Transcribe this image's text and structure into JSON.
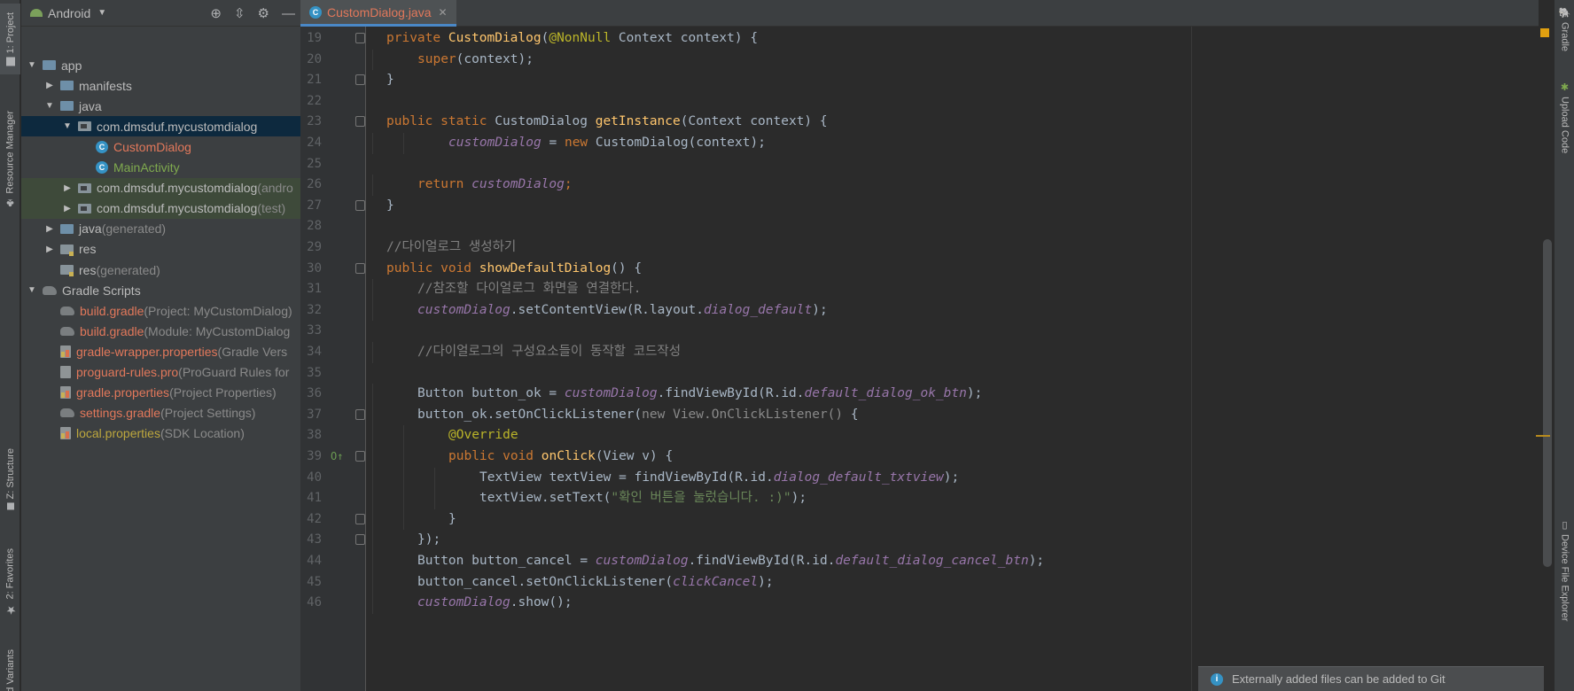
{
  "left_tabs": [
    "1: Project",
    "Resource Manager",
    "Z: Structure",
    "2: Favorites",
    "Build Variants"
  ],
  "project": {
    "view_mode": "Android",
    "tree": [
      {
        "label": "app",
        "suffix": "",
        "depth": 0,
        "arrow": "▼",
        "icon": "folder-app",
        "color": "default",
        "state": ""
      },
      {
        "label": "manifests",
        "suffix": "",
        "depth": 1,
        "arrow": "▶",
        "icon": "folder",
        "color": "default",
        "state": ""
      },
      {
        "label": "java",
        "suffix": "",
        "depth": 1,
        "arrow": "▼",
        "icon": "folder-blue",
        "color": "default",
        "state": ""
      },
      {
        "label": "com.dmsduf.mycustomdialog",
        "suffix": "",
        "depth": 2,
        "arrow": "▼",
        "icon": "package",
        "color": "default",
        "state": "selected"
      },
      {
        "label": "CustomDialog",
        "suffix": "",
        "depth": 3,
        "arrow": "",
        "icon": "class",
        "color": "red",
        "state": ""
      },
      {
        "label": "MainActivity",
        "suffix": "",
        "depth": 3,
        "arrow": "",
        "icon": "class",
        "color": "green",
        "state": ""
      },
      {
        "label": "com.dmsduf.mycustomdialog",
        "suffix": "(andro",
        "depth": 2,
        "arrow": "▶",
        "icon": "package",
        "color": "default",
        "state": "test"
      },
      {
        "label": "com.dmsduf.mycustomdialog",
        "suffix": "(test)",
        "depth": 2,
        "arrow": "▶",
        "icon": "package",
        "color": "default",
        "state": "test"
      },
      {
        "label": "java",
        "suffix": "(generated)",
        "depth": 1,
        "arrow": "▶",
        "icon": "folder-blue",
        "color": "default",
        "state": ""
      },
      {
        "label": "res",
        "suffix": "",
        "depth": 1,
        "arrow": "▶",
        "icon": "folder-res",
        "color": "default",
        "state": ""
      },
      {
        "label": "res",
        "suffix": "(generated)",
        "depth": 1,
        "arrow": "",
        "icon": "folder-res",
        "color": "default",
        "state": ""
      },
      {
        "label": "Gradle Scripts",
        "suffix": "",
        "depth": 0,
        "arrow": "▼",
        "icon": "gradle",
        "color": "default",
        "state": ""
      },
      {
        "label": "build.gradle",
        "suffix": "(Project: MyCustomDialog)",
        "depth": 1,
        "arrow": "",
        "icon": "gradle",
        "color": "red",
        "state": ""
      },
      {
        "label": "build.gradle",
        "suffix": "(Module: MyCustomDialog",
        "depth": 1,
        "arrow": "",
        "icon": "gradle",
        "color": "red",
        "state": ""
      },
      {
        "label": "gradle-wrapper.properties",
        "suffix": "(Gradle Vers",
        "depth": 1,
        "arrow": "",
        "icon": "properties",
        "color": "red",
        "state": ""
      },
      {
        "label": "proguard-rules.pro",
        "suffix": "(ProGuard Rules for",
        "depth": 1,
        "arrow": "",
        "icon": "file",
        "color": "red",
        "state": ""
      },
      {
        "label": "gradle.properties",
        "suffix": "(Project Properties)",
        "depth": 1,
        "arrow": "",
        "icon": "properties",
        "color": "red",
        "state": ""
      },
      {
        "label": "settings.gradle",
        "suffix": "(Project Settings)",
        "depth": 1,
        "arrow": "",
        "icon": "gradle",
        "color": "red",
        "state": ""
      },
      {
        "label": "local.properties",
        "suffix": "(SDK Location)",
        "depth": 1,
        "arrow": "",
        "icon": "properties",
        "color": "yellow",
        "state": ""
      }
    ]
  },
  "editor": {
    "tab_label": "CustomDialog.java",
    "lines": [
      {
        "n": 19,
        "indent": 1,
        "fold": true,
        "marker": "",
        "tokens": [
          [
            "k",
            "private "
          ],
          [
            "f",
            "CustomDialog"
          ],
          [
            "p",
            "("
          ],
          [
            "an",
            "@NonNull"
          ],
          [
            "p",
            " Context context) {"
          ]
        ]
      },
      {
        "n": 20,
        "indent": 2,
        "fold": false,
        "marker": "",
        "tokens": [
          [
            "k",
            "super"
          ],
          [
            "p",
            "(context);"
          ]
        ]
      },
      {
        "n": 21,
        "indent": 1,
        "fold": true,
        "marker": "",
        "tokens": [
          [
            "p",
            "}"
          ]
        ]
      },
      {
        "n": 22,
        "indent": 0,
        "fold": false,
        "marker": "",
        "tokens": []
      },
      {
        "n": 23,
        "indent": 1,
        "fold": true,
        "marker": "",
        "tokens": [
          [
            "k",
            "public static "
          ],
          [
            "p",
            "CustomDialog "
          ],
          [
            "f",
            "getInstance"
          ],
          [
            "p",
            "(Context context) {"
          ]
        ]
      },
      {
        "n": 24,
        "indent": 3,
        "fold": false,
        "marker": "",
        "tokens": [
          [
            "iv",
            "customDialog"
          ],
          [
            "p",
            " = "
          ],
          [
            "k",
            "new "
          ],
          [
            "p",
            "CustomDialog(context);"
          ]
        ]
      },
      {
        "n": 25,
        "indent": 0,
        "fold": false,
        "marker": "",
        "tokens": []
      },
      {
        "n": 26,
        "indent": 2,
        "fold": false,
        "marker": "",
        "tokens": [
          [
            "k",
            "return "
          ],
          [
            "iv",
            "customDialog"
          ],
          [
            "k",
            ";"
          ]
        ]
      },
      {
        "n": 27,
        "indent": 1,
        "fold": true,
        "marker": "",
        "tokens": [
          [
            "p",
            "}"
          ]
        ]
      },
      {
        "n": 28,
        "indent": 0,
        "fold": false,
        "marker": "",
        "tokens": []
      },
      {
        "n": 29,
        "indent": 1,
        "fold": false,
        "marker": "",
        "tokens": [
          [
            "c",
            "//다이얼로그 생성하기"
          ]
        ]
      },
      {
        "n": 30,
        "indent": 1,
        "fold": true,
        "marker": "",
        "tokens": [
          [
            "k",
            "public void "
          ],
          [
            "f",
            "showDefaultDialog"
          ],
          [
            "p",
            "() {"
          ]
        ]
      },
      {
        "n": 31,
        "indent": 2,
        "fold": false,
        "marker": "",
        "tokens": [
          [
            "c",
            "//참조할 다이얼로그 화면을 연결한다."
          ]
        ]
      },
      {
        "n": 32,
        "indent": 2,
        "fold": false,
        "marker": "",
        "tokens": [
          [
            "iv",
            "customDialog"
          ],
          [
            "p",
            ".setContentView(R.layout."
          ],
          [
            "iv",
            "dialog_default"
          ],
          [
            "p",
            ");"
          ]
        ]
      },
      {
        "n": 33,
        "indent": 0,
        "fold": false,
        "marker": "",
        "tokens": []
      },
      {
        "n": 34,
        "indent": 2,
        "fold": false,
        "marker": "",
        "tokens": [
          [
            "c",
            "//다이얼로그의 구성요소들이 동작할 코드작성"
          ]
        ]
      },
      {
        "n": 35,
        "indent": 0,
        "fold": false,
        "marker": "",
        "tokens": []
      },
      {
        "n": 36,
        "indent": 2,
        "fold": false,
        "marker": "",
        "tokens": [
          [
            "p",
            "Button button_ok = "
          ],
          [
            "iv",
            "customDialog"
          ],
          [
            "p",
            ".findViewById(R.id."
          ],
          [
            "iv",
            "default_dialog_ok_btn"
          ],
          [
            "p",
            ");"
          ]
        ]
      },
      {
        "n": 37,
        "indent": 2,
        "fold": true,
        "marker": "",
        "tokens": [
          [
            "p",
            "button_ok.setOnClickListener("
          ],
          [
            "g",
            "new View.OnClickListener() "
          ],
          [
            "p",
            "{"
          ]
        ]
      },
      {
        "n": 38,
        "indent": 3,
        "fold": false,
        "marker": "",
        "tokens": [
          [
            "an",
            "@Override"
          ]
        ]
      },
      {
        "n": 39,
        "indent": 3,
        "fold": true,
        "marker": "O↑",
        "tokens": [
          [
            "k",
            "public void "
          ],
          [
            "f",
            "onClick"
          ],
          [
            "p",
            "(View v) {"
          ]
        ]
      },
      {
        "n": 40,
        "indent": 4,
        "fold": false,
        "marker": "",
        "tokens": [
          [
            "p",
            "TextView textView = findViewById(R.id."
          ],
          [
            "iv",
            "dialog_default_txtview"
          ],
          [
            "p",
            ");"
          ]
        ]
      },
      {
        "n": 41,
        "indent": 4,
        "fold": false,
        "marker": "",
        "tokens": [
          [
            "p",
            "textView.setText("
          ],
          [
            "s",
            "\"확인 버튼을 눌렀습니다. :)\""
          ],
          [
            "p",
            ");"
          ]
        ]
      },
      {
        "n": 42,
        "indent": 3,
        "fold": true,
        "marker": "",
        "tokens": [
          [
            "p",
            "}"
          ]
        ]
      },
      {
        "n": 43,
        "indent": 2,
        "fold": true,
        "marker": "",
        "tokens": [
          [
            "p",
            "});"
          ]
        ]
      },
      {
        "n": 44,
        "indent": 2,
        "fold": false,
        "marker": "",
        "tokens": [
          [
            "p",
            "Button button_cancel = "
          ],
          [
            "iv",
            "customDialog"
          ],
          [
            "p",
            ".findViewById(R.id."
          ],
          [
            "iv",
            "default_dialog_cancel_btn"
          ],
          [
            "p",
            ");"
          ]
        ]
      },
      {
        "n": 45,
        "indent": 2,
        "fold": false,
        "marker": "",
        "tokens": [
          [
            "p",
            "button_cancel.setOnClickListener("
          ],
          [
            "iv",
            "clickCancel"
          ],
          [
            "p",
            ");"
          ]
        ]
      },
      {
        "n": 46,
        "indent": 2,
        "fold": false,
        "marker": "",
        "tokens": [
          [
            "iv",
            "customDialog"
          ],
          [
            "p",
            ".show();"
          ]
        ]
      }
    ]
  },
  "right_tabs": [
    "Gradle",
    "Upload Code",
    "Device File Explorer"
  ],
  "notification": {
    "text": "Externally added files can be added to Git"
  },
  "colors": {
    "accent": "#4a88c7",
    "selection": "#0d293e",
    "warning_marker": "#e0a010"
  }
}
